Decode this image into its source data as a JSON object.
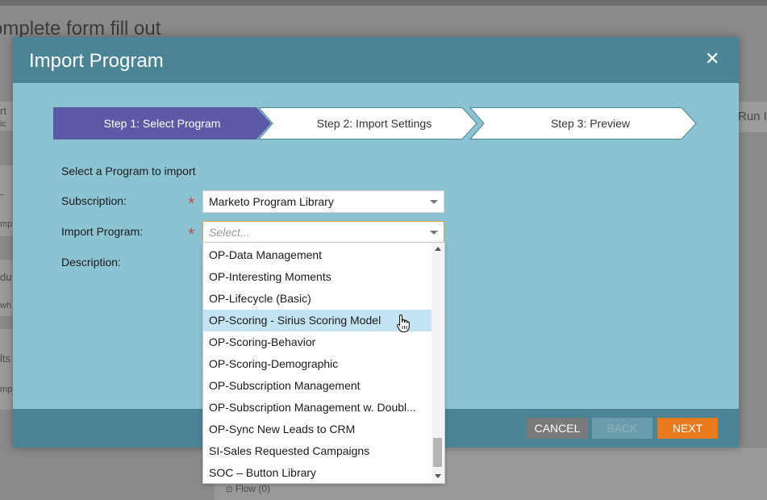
{
  "background": {
    "page_title": "omplete form fill out",
    "side_snippets": [
      "rt",
      "ic",
      "-",
      "mp",
      "du",
      "wh",
      "lts",
      "mpa"
    ],
    "right_snippet": "Run I",
    "flow_label": "Flow (0)"
  },
  "modal": {
    "title": "Import Program",
    "close_icon": "close-icon",
    "steps": [
      {
        "label": "Step 1: Select Program",
        "active": true
      },
      {
        "label": "Step 2: Import Settings",
        "active": false
      },
      {
        "label": "Step 3: Preview",
        "active": false
      }
    ],
    "form": {
      "lead": "Select a Program to import",
      "subscription_label": "Subscription:",
      "subscription_value": "Marketo Program Library",
      "import_program_label": "Import Program:",
      "import_program_placeholder": "Select...",
      "description_label": "Description:",
      "required_mark": "*"
    },
    "footer": {
      "cancel": "CANCEL",
      "back": "BACK",
      "next": "NEXT"
    }
  },
  "dropdown": {
    "items": [
      "OP-Data Management",
      "OP-Interesting Moments",
      "OP-Lifecycle (Basic)",
      "OP-Scoring - Sirius Scoring Model",
      "OP-Scoring-Behavior",
      "OP-Scoring-Demographic",
      "OP-Subscription Management",
      "OP-Subscription Management w. Doubl...",
      "OP-Sync New Leads to CRM",
      "SI-Sales Requested Campaigns",
      "SOC – Button Library"
    ],
    "highlighted_index": 3
  },
  "colors": {
    "modal_header": "#4a8495",
    "modal_body": "#8bc3d3",
    "step_active": "#5c59a6",
    "next_button": "#e87b1e",
    "cancel_button": "#7a7a7a",
    "highlight": "#c4e4f3"
  }
}
